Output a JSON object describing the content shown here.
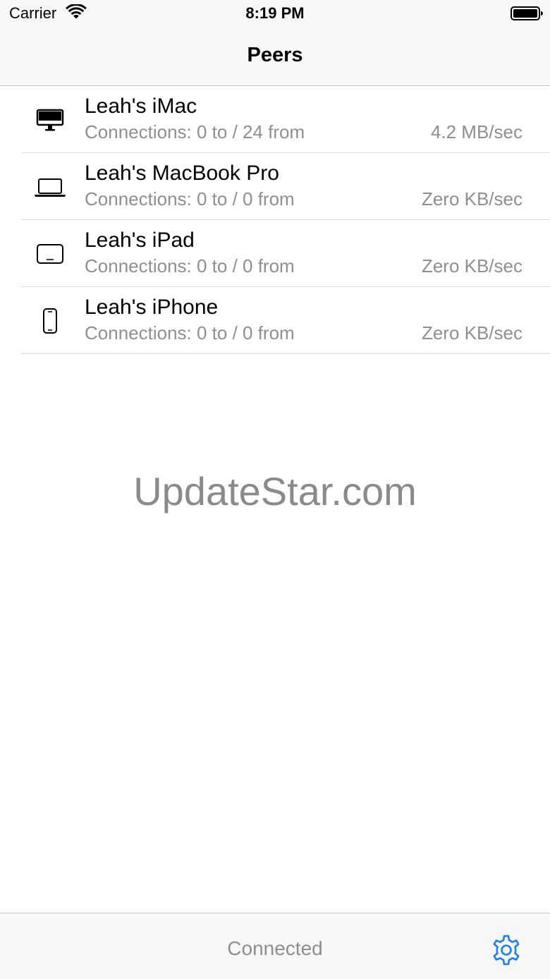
{
  "status_bar": {
    "carrier": "Carrier",
    "time": "8:19 PM",
    "wifi_icon": "wifi-icon",
    "battery_icon": "battery-full-icon"
  },
  "nav": {
    "title": "Peers"
  },
  "peers": [
    {
      "icon": "imac-icon",
      "name": "Leah's iMac",
      "connections": "Connections: 0 to / 24 from",
      "rate": "4.2 MB/sec"
    },
    {
      "icon": "macbook-icon",
      "name": "Leah's MacBook Pro",
      "connections": "Connections: 0 to / 0 from",
      "rate": "Zero KB/sec"
    },
    {
      "icon": "ipad-icon",
      "name": "Leah's iPad",
      "connections": "Connections: 0 to / 0 from",
      "rate": "Zero KB/sec"
    },
    {
      "icon": "iphone-icon",
      "name": "Leah's iPhone",
      "connections": "Connections: 0 to / 0 from",
      "rate": "Zero KB/sec"
    }
  ],
  "watermark": "UpdateStar.com",
  "toolbar": {
    "status": "Connected",
    "settings_icon": "gear-icon"
  },
  "colors": {
    "accent": "#1a7ff5",
    "secondary_text": "#8e8e93",
    "bar_background": "#f7f7f7",
    "separator": "#dcdcdf"
  }
}
